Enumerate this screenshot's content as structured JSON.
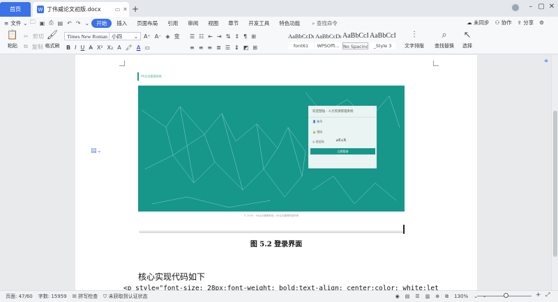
{
  "tabs": {
    "home": "首页",
    "document": "丁伟威论文初版.docx"
  },
  "menu": {
    "file": "文件",
    "items": [
      "开始",
      "插入",
      "页面布局",
      "引用",
      "审阅",
      "视图",
      "章节",
      "开发工具",
      "特色功能"
    ],
    "search": "查找命令",
    "right": [
      "未同步",
      "协作",
      "分享"
    ]
  },
  "toolbar": {
    "paste": "粘贴",
    "cut": "剪切",
    "copy": "复制",
    "format_painter": "格式刷",
    "font_name": "Times New Roman",
    "font_size": "小四",
    "text_layout": "文字排版",
    "find_replace": "查找替换",
    "select": "选择"
  },
  "styles": [
    {
      "preview": "AaBbCcDd",
      "name": "font61"
    },
    {
      "preview": "AaBbCcDd",
      "name": "WPSOffi..."
    },
    {
      "preview": "AaBbCcI",
      "name": "No Spacing"
    },
    {
      "preview": "AaBbCcI",
      "name": "_Style 3"
    }
  ],
  "document": {
    "thumb_caption": "XX企业管理系统",
    "login_title": "欢迎登陆 - 人力资源管理系统",
    "field_account": "账号",
    "field_password": "密码",
    "field_captcha": "验证码",
    "captcha_value": "aEsX",
    "login_button": "立即登录",
    "footer_note": "© 2020 · XX企业管理系统 | XX企业管理系统所有",
    "figure_caption": "图 5.2  登录界面",
    "heading": "核心实现代码如下",
    "code": "<p style=\"font-size: 28px;font-weight: bold;text-align: center;color: white;letter-spacing: 2px;"
  },
  "status": {
    "page": "页面: 47/60",
    "words": "字数: 15959",
    "spell": "拼写检查",
    "cert": "未获取到认证状态",
    "zoom": "130%"
  },
  "colors": {
    "accent": "#3a72e8",
    "teal": "#16978a"
  }
}
